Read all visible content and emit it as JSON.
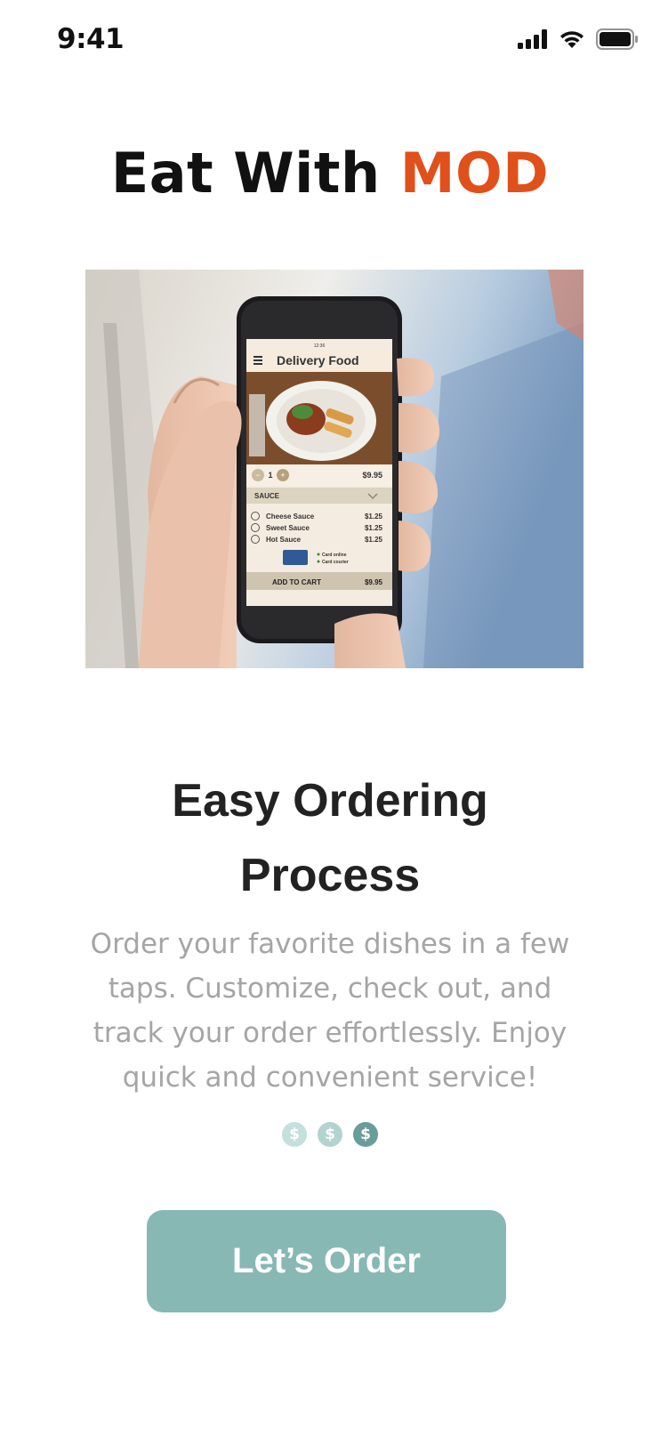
{
  "status_bar": {
    "time": "9:41"
  },
  "brand": {
    "part1": "Eat With ",
    "part2": "MOD",
    "accent_color": "#e0501a"
  },
  "hero": {
    "phone_time": "12:36",
    "app_title": "Delivery Food",
    "quantity": "1",
    "item_price": "$9.95",
    "section_label": "SAUCE",
    "options": [
      {
        "name": "Cheese Sauce",
        "price": "$1.25"
      },
      {
        "name": "Sweet Sauce",
        "price": "$1.25"
      },
      {
        "name": "Hot Sauce",
        "price": "$1.25"
      }
    ],
    "payment_methods": [
      "Card online",
      "Card courier"
    ],
    "cart_label": "ADD TO CART",
    "cart_total": "$9.95"
  },
  "headline": {
    "line1": "Easy Ordering",
    "line2": "Process"
  },
  "description": {
    "line1": "Order your favorite dishes in a few",
    "line2": "taps. Customize, check out, and",
    "line3": "track your order effortlessly. Enjoy",
    "line4": "quick and convenient service!"
  },
  "pager": {
    "dots": [
      {
        "glyph": "$",
        "color": "#c3e0dc"
      },
      {
        "glyph": "$",
        "color": "#b3d3cf"
      },
      {
        "glyph": "$",
        "color": "#6a9d99"
      }
    ],
    "active_index": 2
  },
  "cta": {
    "label": "Let’s Order",
    "color": "#87b8b4"
  }
}
